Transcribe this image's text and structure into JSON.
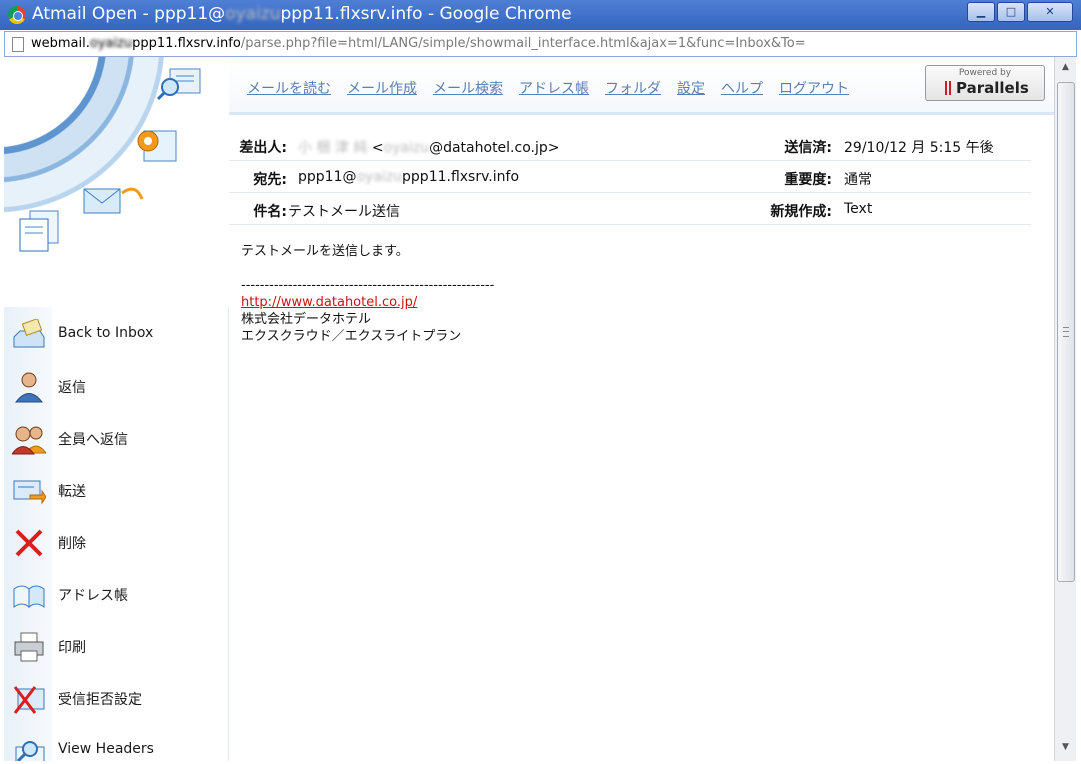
{
  "window": {
    "title_prefix": "Atmail Open - ppp11@",
    "title_blurred": "oyaizu",
    "title_suffix": "ppp11.flxsrv.info - Google Chrome",
    "min_label": "▁",
    "max_label": "□",
    "close_label": "✕"
  },
  "address": {
    "host_prefix": "webmail.",
    "host_blurred": "oyaizu",
    "host_suffix": "ppp11.flxsrv.info",
    "path": "/parse.php?file=html/LANG/simple/showmail_interface.html&ajax=1&func=Inbox&To="
  },
  "nav": {
    "links": [
      "メールを読む",
      "メール作成",
      "メール検索",
      "アドレス帳",
      "フォルダ",
      "設定",
      "ヘルプ",
      "ログアウト"
    ],
    "powered_by": "Powered by",
    "brand": "Parallels"
  },
  "headers": {
    "from_label": "差出人:",
    "from_name_blurred": "小 梱 津  純",
    "from_lt": "<",
    "from_email_blurred": "oyaizu",
    "from_email_suffix": "@datahotel.co.jp>",
    "to_label": "宛先:",
    "to_prefix": "ppp11@",
    "to_blurred": "oyaizu",
    "to_suffix": "ppp11.flxsrv.info",
    "subject_label": "件名:",
    "subject": "テストメール送信",
    "sent_label": "送信済:",
    "sent": "29/10/12 月 5:15 午後",
    "priority_label": "重要度:",
    "priority": "通常",
    "format_label": "新規作成:",
    "format": "Text"
  },
  "body": {
    "line1": "テストメールを送信します。",
    "divider": "------------------------------------------------------",
    "link": "http://www.datahotel.co.jp/",
    "company": "株式会社データホテル",
    "plan": "エクスクラウド／エクスライトプラン"
  },
  "sidebar": {
    "items": [
      {
        "label": "Back to Inbox"
      },
      {
        "label": "返信"
      },
      {
        "label": "全員へ返信"
      },
      {
        "label": "転送"
      },
      {
        "label": "削除"
      },
      {
        "label": "アドレス帳"
      },
      {
        "label": "印刷"
      },
      {
        "label": "受信拒否設定"
      },
      {
        "label": "View Headers"
      }
    ]
  },
  "colors": {
    "title_bar": "#3465bf",
    "nav_link": "#5b7fb1",
    "body_link": "#cc1111",
    "delete_red": "#d81e1e",
    "brand_red": "#d01c25"
  }
}
